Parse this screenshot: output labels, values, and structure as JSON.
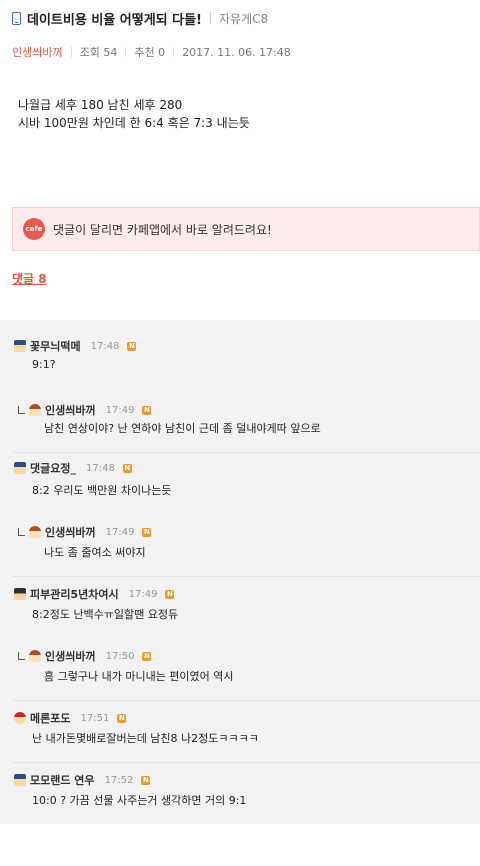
{
  "post": {
    "title": "데이트비용 비율 어떻게되 다들!",
    "board": "자유게C8",
    "author": "인생씌바꺼",
    "views": "조회 54",
    "likes": "추천 0",
    "datetime": "2017. 11. 06.  17:48",
    "body_lines": [
      "나월급 세후 180 남친 세후 280",
      "시바 100만원 차인데 한 6:4 혹은 7:3 내는듯"
    ]
  },
  "banner": {
    "logo": "cafe",
    "text": "댓글이 달리면 카페앱에서 바로 알려드려요!"
  },
  "comments_header": "댓글 8",
  "comments": [
    {
      "nick": "꽃무늬떡메",
      "time": "17:48",
      "text": "9:1?",
      "reply": false,
      "avatar": "a1"
    },
    {
      "nick": "인생씌바꺼",
      "time": "17:49",
      "text": "남친 연상이야? 난 연하야 남친이 근데 좀 덜내야게따 앞으로",
      "reply": true,
      "avatar": "a2"
    },
    {
      "nick": "댓글요정_",
      "time": "17:48",
      "text": "8:2 우리도 백만원 차이나는듯",
      "reply": false,
      "avatar": "a1"
    },
    {
      "nick": "인생씌바꺼",
      "time": "17:49",
      "text": "나도 좀 줄여소 써야지",
      "reply": true,
      "avatar": "a2"
    },
    {
      "nick": "피부관리5년차여시",
      "time": "17:49",
      "text": "8:2정도 난백수ㅠ일할땐 요정듀",
      "reply": false,
      "avatar": "a3"
    },
    {
      "nick": "인생씌바꺼",
      "time": "17:50",
      "text": "흠 그렇구나 내가 마니내는 편이였어 역시",
      "reply": true,
      "avatar": "a2"
    },
    {
      "nick": "메론포도",
      "time": "17:51",
      "text": "난 내가돈몇배로잘버는데 남친8 나2정도ㅋㅋㅋㅋ",
      "reply": false,
      "avatar": "a4"
    },
    {
      "nick": "모모랜드 연우",
      "time": "17:52",
      "text": "10:0 ? 가끔 선물 사주는거 생각하면 거의 9:1",
      "reply": false,
      "avatar": "a1"
    }
  ],
  "badge_label": "N"
}
